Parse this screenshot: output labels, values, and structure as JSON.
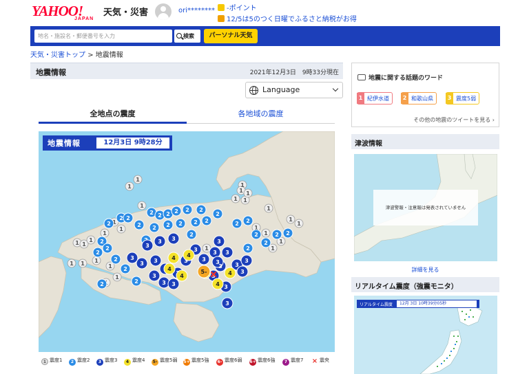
{
  "header": {
    "logo_main": "YAHOO!",
    "logo_sub": "JAPAN",
    "section_title": "天気・災害",
    "username": "ori********",
    "promo_points": "-ポイント",
    "promo_campaign": "12/5は5のつく日曜でふるさと納税がお得"
  },
  "search": {
    "placeholder": "地名・施設名・郵便番号を入力",
    "button_label": "検索",
    "personal_label": "パーソナル天気"
  },
  "breadcrumb": {
    "home": "天気・災害トップ",
    "separator": ">",
    "current": "地震情報"
  },
  "main": {
    "title": "地震情報",
    "datetime": "2021年12月3日　9時33分現在",
    "language_label": "Language",
    "tabs": [
      {
        "label": "全地点の震度"
      },
      {
        "label": "各地域の震度"
      }
    ],
    "map_badge_label": "地震情報",
    "map_badge_time": "12月3日 9時28分"
  },
  "legend": [
    {
      "symbol": "1",
      "label": "震度1",
      "color": "#e0e0e0"
    },
    {
      "symbol": "2",
      "label": "震度2",
      "color": "#2b8ce6"
    },
    {
      "symbol": "3",
      "label": "震度3",
      "color": "#1c3fba"
    },
    {
      "symbol": "4",
      "label": "震度4",
      "color": "#f4e22a"
    },
    {
      "symbol": "5-",
      "label": "震度5弱",
      "color": "#f5a623"
    },
    {
      "symbol": "5+",
      "label": "震度5強",
      "color": "#f07a00"
    },
    {
      "symbol": "6-",
      "label": "震度6弱",
      "color": "#e8322c"
    },
    {
      "symbol": "6+",
      "label": "震度6強",
      "color": "#c0142a"
    },
    {
      "symbol": "7",
      "label": "震度7",
      "color": "#9c1a8a"
    },
    {
      "symbol": "×",
      "label": "震央",
      "color": "#e8322c"
    }
  ],
  "trends": {
    "title": "地震に関する話題のワード",
    "items": [
      {
        "rank": "1",
        "word": "紀伊水道",
        "color": "#f07a80"
      },
      {
        "rank": "2",
        "word": "和歌山県",
        "color": "#f5a04a"
      },
      {
        "rank": "3",
        "word": "震度5弱",
        "color": "#f4c822"
      }
    ],
    "more_label": "その他の地震のツイートを見る ›"
  },
  "tsunami": {
    "title": "津波情報",
    "note": "津波警報・注意報は発表されていません",
    "detail_link": "詳細を見る"
  },
  "monitor": {
    "title": "リアルタイム震度（強震モニタ）",
    "bar_label": "リアルタイム震度",
    "bar_time": "12月 3日 10時39分05秒"
  },
  "colors": {
    "brand_red": "#ff0033",
    "nav_blue": "#1c3fba",
    "link_blue": "#1a4fd6",
    "accent_yellow": "#ffd200"
  }
}
